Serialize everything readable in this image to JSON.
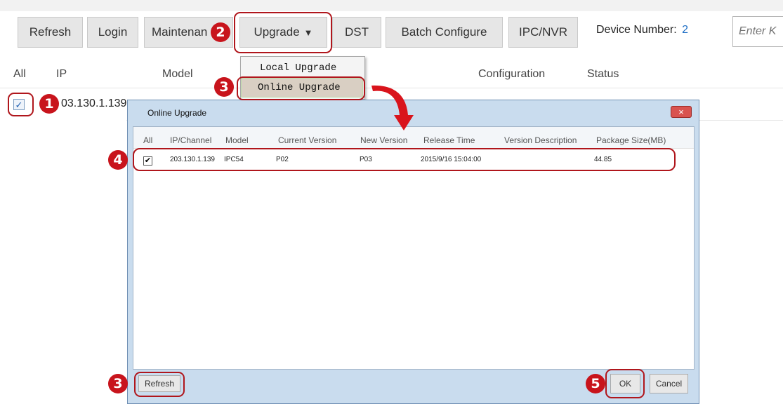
{
  "toolbar": {
    "refresh": "Refresh",
    "login": "Login",
    "maintenance": "Maintenan",
    "upgrade": "Upgrade",
    "upgrade_arrow": "▼",
    "dst": "DST",
    "batch_configure": "Batch Configure",
    "ipc_nvr": "IPC/NVR",
    "device_number_label": "Device Number:",
    "device_number_value": "2",
    "search_placeholder": "Enter K"
  },
  "upgrade_menu": {
    "items": [
      "Local Upgrade",
      "Online Upgrade"
    ]
  },
  "device_table": {
    "columns": [
      "All",
      "IP",
      "Model",
      "Configuration",
      "Status"
    ],
    "row": {
      "checked": true,
      "ip_partial": "03.130.1.139"
    }
  },
  "dialog": {
    "title": "Online Upgrade",
    "close_glyph": "×",
    "columns": [
      "All",
      "IP/Channel",
      "Model",
      "Current Version",
      "New Version",
      "Release Time",
      "Version Description",
      "Package Size(MB)"
    ],
    "rows": [
      {
        "checked": true,
        "ip": "203.130.1.139",
        "model": "IPC54",
        "current_version": "P02",
        "new_version": "P03",
        "release_time": "2015/9/16 15:04:00",
        "description": "",
        "size": "44.85"
      }
    ],
    "refresh_button": "Refresh",
    "ok_button": "OK",
    "cancel_button": "Cancel"
  },
  "markers": [
    "1",
    "2",
    "3",
    "3",
    "4",
    "5"
  ],
  "colors": {
    "highlight": "#b0161c",
    "marker": "#c8141c",
    "link": "#1f6fc5",
    "close_button": "#d9534f"
  },
  "icons": {
    "check": "check-icon",
    "dropdown": "caret-down-icon",
    "close": "close-icon",
    "arrow": "curved-arrow-icon"
  }
}
